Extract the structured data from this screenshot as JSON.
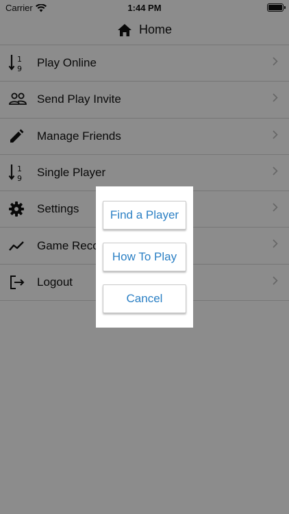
{
  "status_bar": {
    "carrier": "Carrier",
    "time": "1:44 PM"
  },
  "nav": {
    "title": "Home",
    "icon": "home-icon"
  },
  "menu": {
    "items": [
      {
        "label": "Play Online",
        "icon": "sort-numeric-icon"
      },
      {
        "label": "Send Play Invite",
        "icon": "people-icon"
      },
      {
        "label": "Manage Friends",
        "icon": "pencil-icon"
      },
      {
        "label": "Single Player",
        "icon": "sort-numeric-icon"
      },
      {
        "label": "Settings",
        "icon": "gear-icon"
      },
      {
        "label": "Game Reco",
        "icon": "trend-icon"
      },
      {
        "label": "Logout",
        "icon": "logout-icon"
      }
    ]
  },
  "dialog": {
    "find_player": "Find a Player",
    "how_to_play": "How To Play",
    "cancel": "Cancel"
  },
  "colors": {
    "accent": "#2a7fc4",
    "overlay": "rgba(0,0,0,0.45)",
    "divider": "#d8d8d8"
  }
}
